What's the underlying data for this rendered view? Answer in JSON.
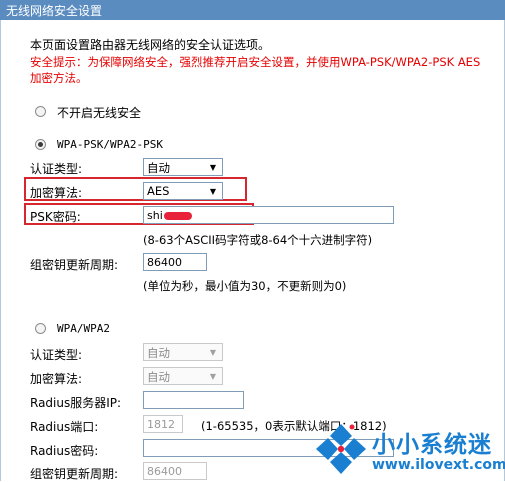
{
  "header": {
    "title": "无线网络安全设置"
  },
  "intro": "本页面设置路由器无线网络的安全认证选项。",
  "warning": {
    "line1": "安全提示：为保障网络安全，强烈推荐开启安全设置，并使用WPA-PSK/WPA2-PSK AES",
    "line2": "加密方法。"
  },
  "no_security": {
    "label": "不开启无线安全"
  },
  "wpa_psk": {
    "label": "WPA-PSK/WPA2-PSK",
    "auth_type_label": "认证类型:",
    "auth_type_value": "自动",
    "encryption_label": "加密算法:",
    "encryption_value": "AES",
    "psk_label": "PSK密码:",
    "psk_value": "shi",
    "psk_hint": "(8-63个ASCII码字符或8-64个十六进制字符)",
    "rekey_label": "组密钥更新周期:",
    "rekey_value": "86400",
    "rekey_hint": "(单位为秒，最小值为30，不更新则为0)"
  },
  "wpa": {
    "label": "WPA/WPA2",
    "auth_type_label": "认证类型:",
    "auth_type_value": "自动",
    "encryption_label": "加密算法:",
    "encryption_value": "自动",
    "radius_ip_label": "Radius服务器IP:",
    "radius_ip_value": "",
    "radius_port_label": "Radius端口:",
    "radius_port_value": "1812",
    "radius_port_hint": "(1-65535，0表示默认端口：1812)",
    "radius_pwd_label": "Radius密码:",
    "radius_pwd_value": "",
    "rekey_label": "组密钥更新周期:",
    "rekey_value": "86400"
  },
  "watermark": {
    "text": "小小系统迷",
    "url": "www.ilovext.com"
  },
  "colors": {
    "header": "#5b8cc0",
    "warning": "#e60000",
    "highlight": "#d7262e",
    "watermark": "#1a7fd0"
  }
}
